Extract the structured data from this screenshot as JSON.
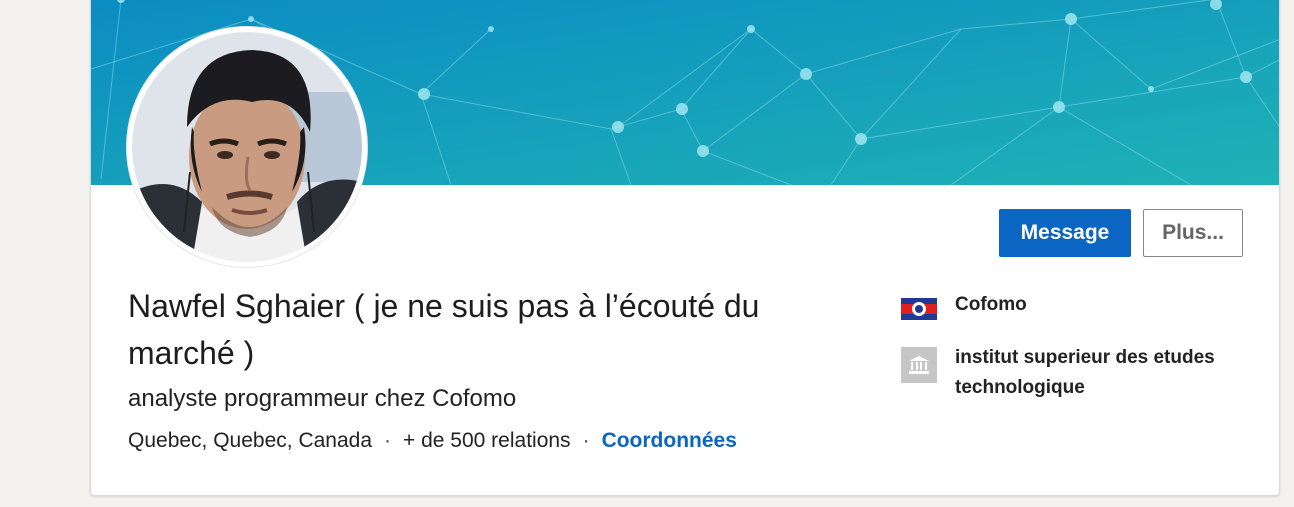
{
  "profile": {
    "name": "Nawfel Sghaier ( je ne suis pas à l’écouté du marché )",
    "headline": "analyste programmeur chez Cofomo",
    "location": "Quebec, Quebec, Canada",
    "connections": "+ de 500 relations",
    "separator": "·",
    "contact_link": "Coordonnées"
  },
  "actions": {
    "message_label": "Message",
    "more_label": "Plus..."
  },
  "aside": {
    "company": "Cofomo",
    "school": "institut superieur des etudes technologique"
  },
  "icons": {
    "company": "cofomo-logo-icon",
    "school": "school-building-icon"
  },
  "colors": {
    "accent": "#0a66c2",
    "banner_start": "#0a8fc0",
    "banner_end": "#21b0b8"
  }
}
